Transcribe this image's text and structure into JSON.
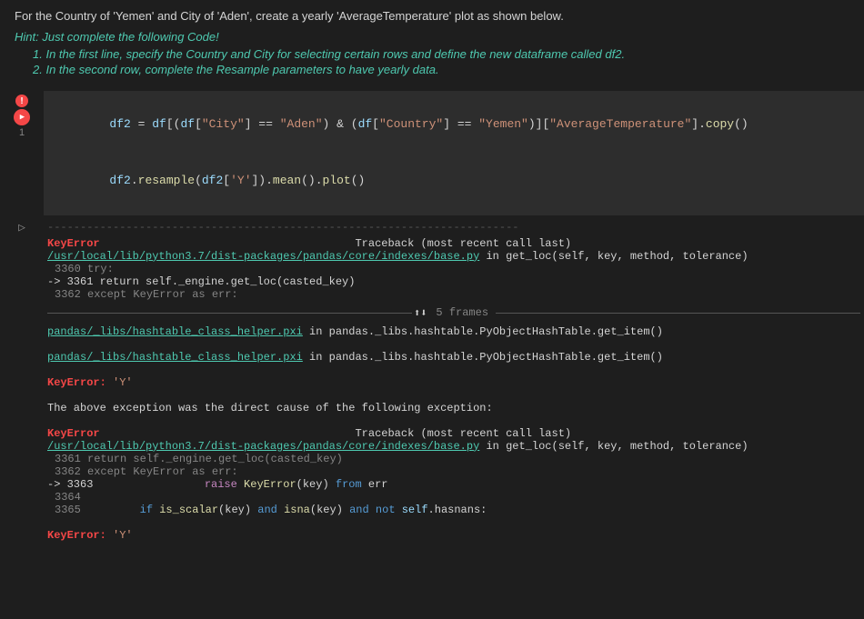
{
  "instruction": {
    "main_text": "For the Country of 'Yemen' and City of 'Aden', create a yearly 'AverageTemperature' plot as shown below.",
    "hint_label": "Hint: Just complete the following Code!",
    "hint_item1": "1. In the first line, specify the Country and City for selecting certain rows and define the new dataframe called df2.",
    "hint_item2": "2. In the second row, complete the Resample parameters to have yearly data."
  },
  "code_cell": {
    "line_number": "1",
    "code_line1": "df2 = df[(df[\"City\"] == \"Aden\") & (df[\"Country\"] == \"Yemen\")][\"AverageTemperature\"].copy()",
    "code_line2": "df2.resample(df2['Y']).mean().plot()"
  },
  "output": {
    "separator": "------------------------------------------------------------------------",
    "error_type1": "KeyError",
    "traceback_header1": "Traceback (most recent call last)",
    "file_link1": "/usr/local/lib/python3.7/dist-packages/pandas/core/indexes/base.py",
    "file_context1": " in get_loc(self, key, method, tolerance)",
    "line_3360": "   3360             try:",
    "line_3361_arrow": "->  3361                 return self._engine.get_loc(casted_key)",
    "line_3362": "    3362         except KeyError as err:",
    "frames_count": "5 frames",
    "pandas_file1": "pandas/_libs/hashtable_class_helper.pxi",
    "pandas_context1": " in pandas._libs.hashtable.PyObjectHashTable.get_item()",
    "pandas_file2": "pandas/_libs/hashtable_class_helper.pxi",
    "pandas_context2": " in pandas._libs.hashtable.PyObjectHashTable.get_item()",
    "key_error1": "KeyError:",
    "key_error1_val": "'Y'",
    "exception_msg": "The above exception was the direct cause of the following exception:",
    "error_type2": "KeyError",
    "traceback_header2": "Traceback (most recent call last)",
    "file_link2": "/usr/local/lib/python3.7/dist-packages/pandas/core/indexes/base.py",
    "file_context2": " in get_loc(self, key, method, tolerance)",
    "line_3361_2": "   3361                 return self._engine.get_loc(casted_key)",
    "line_3362_2": "    3362         except KeyError as err:",
    "line_3363_arrow": "->  3363                 raise KeyError(key) from err",
    "line_3364": "    3364",
    "line_3365": "    3365         if is_scalar(key) and isna(key) and not self.hasnans:",
    "key_error2": "KeyError:",
    "key_error2_val": "'Y'"
  }
}
